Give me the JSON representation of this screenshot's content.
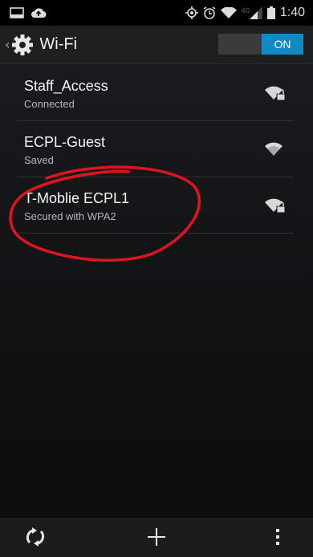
{
  "status_bar": {
    "time": "1:40",
    "network_type": "4G",
    "icons": [
      "screenshot-icon",
      "cloud-upload-icon",
      "location-icon",
      "alarm-icon",
      "wifi-icon",
      "cellular-signal-icon",
      "battery-icon"
    ]
  },
  "action_bar": {
    "title": "Wi-Fi",
    "icon": "settings-gear-icon",
    "toggle_label": "ON"
  },
  "networks": [
    {
      "name": "Staff_Access",
      "status": "Connected",
      "secured": true,
      "icon": "wifi-lock-icon"
    },
    {
      "name": "ECPL-Guest",
      "status": "Saved",
      "secured": false,
      "icon": "wifi-icon"
    },
    {
      "name": "T-Moblie ECPL1",
      "status": "Secured with WPA2",
      "secured": true,
      "icon": "wifi-lock-icon"
    }
  ],
  "bottom_bar": {
    "icons": [
      "scan-refresh-icon",
      "add-network-icon",
      "overflow-menu-icon"
    ]
  },
  "colors": {
    "accent": "#0f8ac4",
    "annotation": "#e0141c",
    "background": "#121315"
  }
}
